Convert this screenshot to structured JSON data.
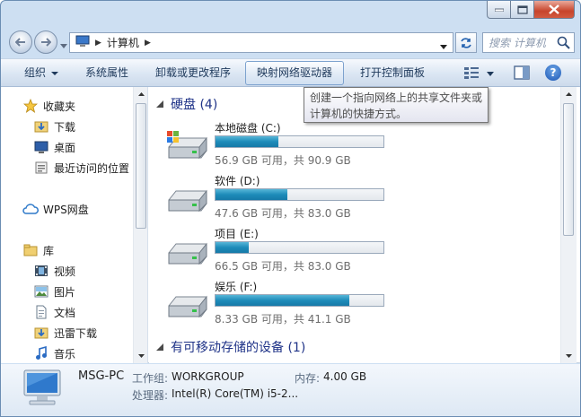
{
  "search": {
    "placeholder": "搜索 计算机"
  },
  "address": {
    "crumbs": [
      "计算机"
    ]
  },
  "toolbar": {
    "organize": "组织",
    "system_properties": "系统属性",
    "uninstall": "卸载或更改程序",
    "map_drive": "映射网络驱动器",
    "control_panel": "打开控制面板"
  },
  "tooltip": {
    "line1": "创建一个指向网络上的共享文件夹或",
    "line2": "计算机的快捷方式。"
  },
  "sidebar": {
    "favorites": {
      "label": "收藏夹",
      "items": [
        "下载",
        "桌面",
        "最近访问的位置"
      ]
    },
    "wps": {
      "label": "WPS网盘"
    },
    "library": {
      "label": "库",
      "items": [
        "视频",
        "图片",
        "文档",
        "迅雷下载",
        "音乐"
      ]
    }
  },
  "groups": {
    "hdd": "硬盘 (4)",
    "removable": "有可移动存储的设备 (1)"
  },
  "drives": [
    {
      "name": "本地磁盘 (C:)",
      "free": "56.9 GB 可用，共 90.9 GB",
      "used_fraction": 0.374,
      "system": true
    },
    {
      "name": "软件 (D:)",
      "free": "47.6 GB 可用，共 83.0 GB",
      "used_fraction": 0.427,
      "system": false
    },
    {
      "name": "项目 (E:)",
      "free": "66.5 GB 可用，共 83.0 GB",
      "used_fraction": 0.199,
      "system": false
    },
    {
      "name": "娱乐 (F:)",
      "free": "8.33 GB 可用，共 41.1 GB",
      "used_fraction": 0.797,
      "system": false
    }
  ],
  "details": {
    "computer_name": "MSG-PC",
    "workgroup_label": "工作组:",
    "workgroup": "WORKGROUP",
    "memory_label": "内存:",
    "memory": "4.00 GB",
    "processor_label": "处理器:",
    "processor": "Intel(R) Core(TM) i5-2..."
  },
  "colors": {
    "accent": "#1e3287",
    "bar_fill": "#1e8bb9",
    "window_frame": "#cddff2"
  }
}
